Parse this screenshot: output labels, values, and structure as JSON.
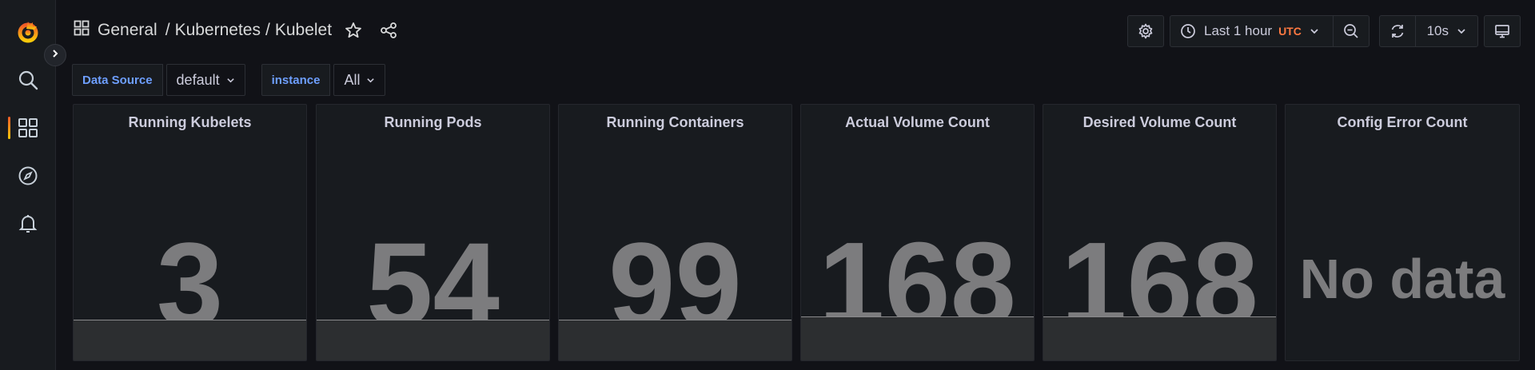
{
  "breadcrumb": {
    "folder": "General",
    "sep1": "/",
    "section": "Kubernetes",
    "sep2": "/",
    "dashboard": "Kubelet"
  },
  "toolbar": {
    "time_range": "Last 1 hour",
    "timezone": "UTC",
    "refresh_interval": "10s"
  },
  "variables": [
    {
      "label": "Data Source",
      "value": "default"
    },
    {
      "label": "instance",
      "value": "All"
    }
  ],
  "panels": [
    {
      "title": "Running Kubelets",
      "value": "3"
    },
    {
      "title": "Running Pods",
      "value": "54"
    },
    {
      "title": "Running Containers",
      "value": "99"
    },
    {
      "title": "Actual Volume Count",
      "value": "168"
    },
    {
      "title": "Desired Volume Count",
      "value": "168"
    },
    {
      "title": "Config Error Count",
      "value": "No data"
    }
  ],
  "colors": {
    "background": "#111217",
    "panel": "#181b1f",
    "value_text": "#7c7c7e",
    "variable_label": "#6e9fff",
    "utc_accent": "#ff7941"
  },
  "icons": {
    "logo": "grafana-logo",
    "sidebar": [
      "search-icon",
      "dashboards-icon",
      "explore-icon",
      "alerting-icon"
    ],
    "nav": [
      "dashboard-grid-icon",
      "star-icon",
      "share-icon"
    ],
    "toolbar": [
      "settings-icon",
      "clock-icon",
      "zoom-out-icon",
      "refresh-icon",
      "tv-mode-icon"
    ]
  }
}
